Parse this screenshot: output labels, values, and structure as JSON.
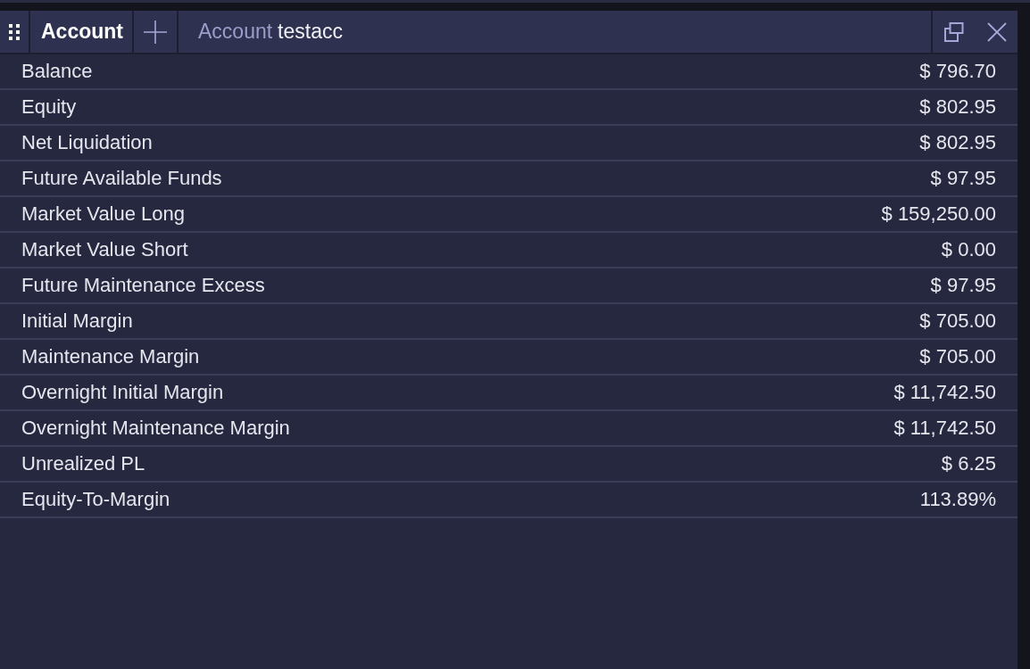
{
  "tabs": [
    {
      "label": "Account",
      "selected": true
    }
  ],
  "title": {
    "label": "Account",
    "account": "testacc"
  },
  "rows": [
    {
      "label": "Balance",
      "value": "$ 796.70"
    },
    {
      "label": "Equity",
      "value": "$ 802.95"
    },
    {
      "label": "Net Liquidation",
      "value": "$ 802.95"
    },
    {
      "label": "Future Available Funds",
      "value": "$ 97.95"
    },
    {
      "label": "Market Value Long",
      "value": "$ 159,250.00"
    },
    {
      "label": "Market Value Short",
      "value": "$ 0.00"
    },
    {
      "label": "Future Maintenance Excess",
      "value": "$ 97.95"
    },
    {
      "label": "Initial Margin",
      "value": "$ 705.00"
    },
    {
      "label": "Maintenance Margin",
      "value": "$ 705.00"
    },
    {
      "label": "Overnight Initial Margin",
      "value": "$ 11,742.50"
    },
    {
      "label": "Overnight Maintenance Margin",
      "value": "$ 11,742.50"
    },
    {
      "label": "Unrealized PL",
      "value": "$ 6.25"
    },
    {
      "label": "Equity-To-Margin",
      "value": "113.89%"
    }
  ]
}
